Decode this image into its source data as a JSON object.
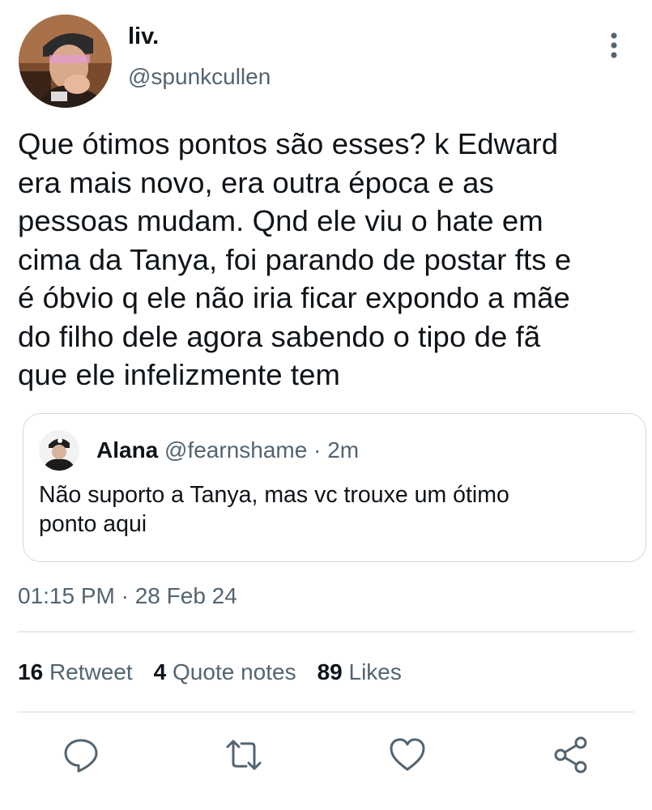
{
  "author": {
    "display_name": "liv.",
    "handle": "@spunkcullen"
  },
  "tweet": {
    "text": "Que ótimos pontos são esses? k Edward\nera mais novo, era outra época e as\npessoas mudam. Qnd ele viu o hate em\ncima da Tanya, foi parando de postar fts e\né óbvio q ele não iria ficar expondo a mãe\ndo filho dele agora sabendo o tipo de fã\nque ele infelizmente tem"
  },
  "quoted_tweet": {
    "display_name": "Alana",
    "meta": "@fearnshame · 2m",
    "text": "Não suporto a Tanya, mas vc trouxe um ótimo\nponto aqui"
  },
  "timestamp": "01:15 PM · 28 Feb 24",
  "stats": {
    "retweets_count": "16",
    "retweets_label": "Retweet",
    "quotes_count": "4",
    "quotes_label": "Quote notes",
    "likes_count": "89",
    "likes_label": "Likes"
  },
  "actions": {
    "reply": "reply-icon",
    "retweet": "retweet-icon",
    "like": "heart-icon",
    "share": "share-icon"
  },
  "colors": {
    "text_primary": "#0f1419",
    "text_secondary": "#536471",
    "divider": "#e6ecf0",
    "border": "#cfd9de"
  }
}
